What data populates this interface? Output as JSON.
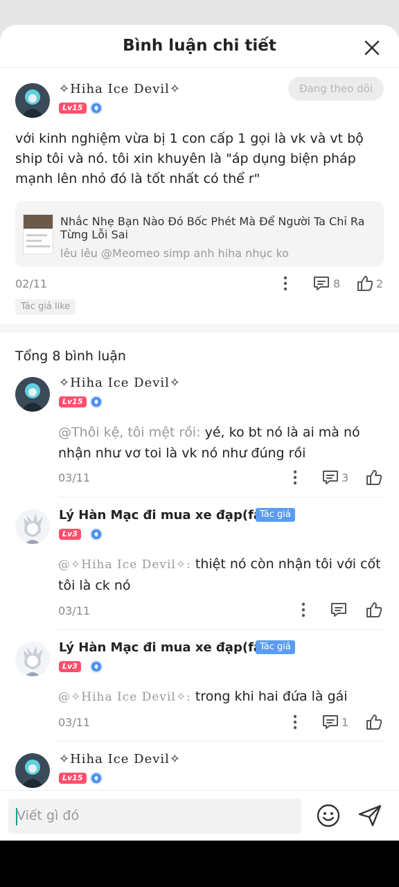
{
  "header": {
    "title": "Bình luận chi tiết"
  },
  "post": {
    "author": "✧Hiha Ice Devil✧",
    "level": "Lv15",
    "follow_label": "Đang theo dõi",
    "text": "với kinh nghiệm vừa bị 1 con cấp 1 gọi là vk và vt bộ ship tôi và nó. tôi xin khuyên là \"áp dụng biện pháp mạnh lên nhỏ đó là tốt nhất có thể r\"",
    "link_card": {
      "title": "Nhắc Nhẹ Bạn Nào Đó Bốc Phét Mà Để Người Ta Chỉ Ra Từng Lỗi Sai",
      "subtitle": "lêu lêu @Meomeo simp anh hiha nhục ko"
    },
    "date": "02/11",
    "comment_count": "8",
    "like_count": "2",
    "author_like_tag": "Tác giả like"
  },
  "comments_total": "Tổng 8 bình luận",
  "comments": [
    {
      "author": "✧Hiha Ice Devil✧",
      "level": "Lv15",
      "mention": "@Thôi kệ, tôi mệt rồi:",
      "text": " yé, ko bt nó là ai mà nó nhận như vơ toi là vk nó như đúng rồi",
      "date": "03/11",
      "reply_count": "3"
    },
    {
      "author": "Lý Hàn Mạc đi mua xe đạp(fa...",
      "author_tag": "Tác giả",
      "level": "Lv3",
      "mention": "@✧Hiha Ice Devil✧:",
      "text": " thiệt nó còn nhận tôi với cốt tôi là ck nó",
      "date": "03/11"
    },
    {
      "author": "Lý Hàn Mạc đi mua xe đạp(fa...",
      "author_tag": "Tác giả",
      "level": "Lv3",
      "mention": "@✧Hiha Ice Devil✧:",
      "text": " trong khi hai đứa là gái",
      "date": "03/11",
      "reply_count": "1"
    },
    {
      "author": "✧Hiha Ice Devil✧",
      "level": "Lv15"
    }
  ],
  "composer": {
    "placeholder": "Viết gì đó"
  },
  "icons": {
    "close": "close-icon",
    "more": "more-vertical-icon",
    "comment": "comment-icon",
    "like": "thumbs-up-icon",
    "emoji": "emoji-icon",
    "send": "send-icon",
    "medal": "medal-icon"
  },
  "colors": {
    "level_badge": "#ff4f6b",
    "author_tag": "#5b9cf0",
    "medal": "#4a8ef0"
  }
}
